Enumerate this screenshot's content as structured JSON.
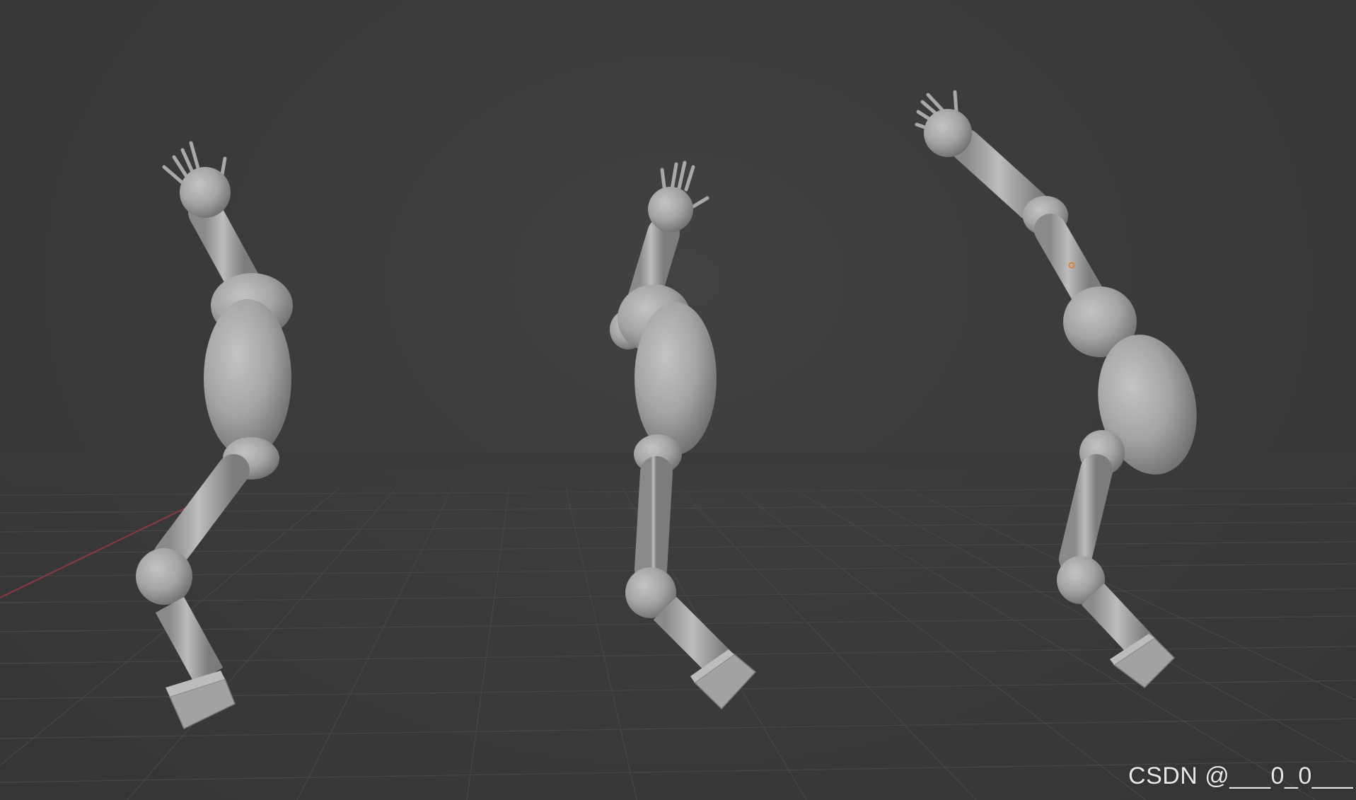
{
  "viewport": {
    "background_color": "#3a3a3a",
    "grid_line_color": "#4a4a4a",
    "x_axis_color": "#8a3a3f",
    "mesh_color": "#a8a8a8",
    "selection_origin_color": "#e07a10"
  },
  "figures": [
    {
      "name": "figure-left"
    },
    {
      "name": "figure-middle"
    },
    {
      "name": "figure-right"
    }
  ],
  "watermark": {
    "text": "CSDN @___0_0___"
  }
}
